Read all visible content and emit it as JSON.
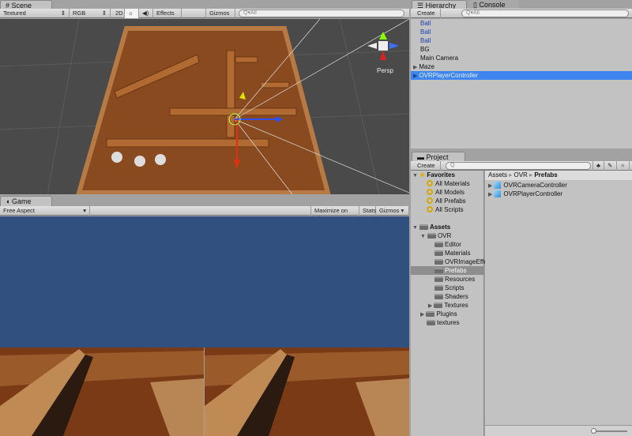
{
  "scene": {
    "tab": "Scene",
    "shading": "Textured",
    "render_mode": "RGB",
    "btn_2d": "2D",
    "effects": "Effects",
    "gizmos": "Gizmos",
    "search_placeholder": "All",
    "persp": "Persp"
  },
  "game": {
    "tab": "Game",
    "aspect": "Free Aspect",
    "maximize": "Maximize on Play",
    "stats": "Stats",
    "gizmos": "Gizmos"
  },
  "hierarchy": {
    "tab": "Hierarchy",
    "console_tab": "Console",
    "create": "Create",
    "search_placeholder": "All",
    "items": [
      {
        "label": "Ball",
        "prefab": true
      },
      {
        "label": "Ball",
        "prefab": true
      },
      {
        "label": "Ball",
        "prefab": true
      },
      {
        "label": "BG"
      },
      {
        "label": "Main Camera"
      },
      {
        "label": "Maze",
        "expandable": true
      },
      {
        "label": "OVRPlayerController",
        "expandable": true,
        "selected": true
      }
    ]
  },
  "project": {
    "tab": "Project",
    "create": "Create",
    "favorites": "Favorites",
    "favorite_items": [
      "All Materials",
      "All Models",
      "All Prefabs",
      "All Scripts"
    ],
    "assets": "Assets",
    "ovr": "OVR",
    "ovr_children": [
      "Editor",
      "Materials",
      "OVRImageEffe",
      "Prefabs",
      "Resources",
      "Scripts",
      "Shaders",
      "Textures"
    ],
    "assets_children": [
      "Plugins",
      "textures"
    ],
    "breadcrumb": [
      "Assets",
      "OVR",
      "Prefabs"
    ],
    "files": [
      "OVRCameraController",
      "OVRPlayerController"
    ]
  },
  "colors": {
    "selection": "#3d86f0",
    "prefab_text": "#1a3fb0",
    "game_sky": "#31507f"
  }
}
